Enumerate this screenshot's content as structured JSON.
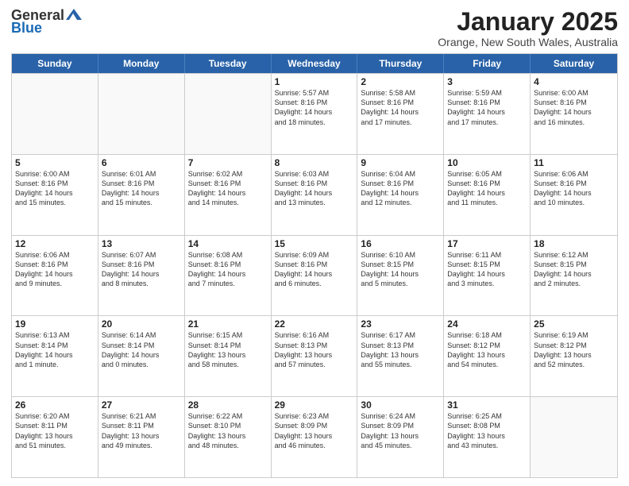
{
  "header": {
    "logo_line1": "General",
    "logo_line2": "Blue",
    "month_title": "January 2025",
    "location": "Orange, New South Wales, Australia"
  },
  "weekdays": [
    "Sunday",
    "Monday",
    "Tuesday",
    "Wednesday",
    "Thursday",
    "Friday",
    "Saturday"
  ],
  "rows": [
    [
      {
        "day": "",
        "info": ""
      },
      {
        "day": "",
        "info": ""
      },
      {
        "day": "",
        "info": ""
      },
      {
        "day": "1",
        "info": "Sunrise: 5:57 AM\nSunset: 8:16 PM\nDaylight: 14 hours\nand 18 minutes."
      },
      {
        "day": "2",
        "info": "Sunrise: 5:58 AM\nSunset: 8:16 PM\nDaylight: 14 hours\nand 17 minutes."
      },
      {
        "day": "3",
        "info": "Sunrise: 5:59 AM\nSunset: 8:16 PM\nDaylight: 14 hours\nand 17 minutes."
      },
      {
        "day": "4",
        "info": "Sunrise: 6:00 AM\nSunset: 8:16 PM\nDaylight: 14 hours\nand 16 minutes."
      }
    ],
    [
      {
        "day": "5",
        "info": "Sunrise: 6:00 AM\nSunset: 8:16 PM\nDaylight: 14 hours\nand 15 minutes."
      },
      {
        "day": "6",
        "info": "Sunrise: 6:01 AM\nSunset: 8:16 PM\nDaylight: 14 hours\nand 15 minutes."
      },
      {
        "day": "7",
        "info": "Sunrise: 6:02 AM\nSunset: 8:16 PM\nDaylight: 14 hours\nand 14 minutes."
      },
      {
        "day": "8",
        "info": "Sunrise: 6:03 AM\nSunset: 8:16 PM\nDaylight: 14 hours\nand 13 minutes."
      },
      {
        "day": "9",
        "info": "Sunrise: 6:04 AM\nSunset: 8:16 PM\nDaylight: 14 hours\nand 12 minutes."
      },
      {
        "day": "10",
        "info": "Sunrise: 6:05 AM\nSunset: 8:16 PM\nDaylight: 14 hours\nand 11 minutes."
      },
      {
        "day": "11",
        "info": "Sunrise: 6:06 AM\nSunset: 8:16 PM\nDaylight: 14 hours\nand 10 minutes."
      }
    ],
    [
      {
        "day": "12",
        "info": "Sunrise: 6:06 AM\nSunset: 8:16 PM\nDaylight: 14 hours\nand 9 minutes."
      },
      {
        "day": "13",
        "info": "Sunrise: 6:07 AM\nSunset: 8:16 PM\nDaylight: 14 hours\nand 8 minutes."
      },
      {
        "day": "14",
        "info": "Sunrise: 6:08 AM\nSunset: 8:16 PM\nDaylight: 14 hours\nand 7 minutes."
      },
      {
        "day": "15",
        "info": "Sunrise: 6:09 AM\nSunset: 8:16 PM\nDaylight: 14 hours\nand 6 minutes."
      },
      {
        "day": "16",
        "info": "Sunrise: 6:10 AM\nSunset: 8:15 PM\nDaylight: 14 hours\nand 5 minutes."
      },
      {
        "day": "17",
        "info": "Sunrise: 6:11 AM\nSunset: 8:15 PM\nDaylight: 14 hours\nand 3 minutes."
      },
      {
        "day": "18",
        "info": "Sunrise: 6:12 AM\nSunset: 8:15 PM\nDaylight: 14 hours\nand 2 minutes."
      }
    ],
    [
      {
        "day": "19",
        "info": "Sunrise: 6:13 AM\nSunset: 8:14 PM\nDaylight: 14 hours\nand 1 minute."
      },
      {
        "day": "20",
        "info": "Sunrise: 6:14 AM\nSunset: 8:14 PM\nDaylight: 14 hours\nand 0 minutes."
      },
      {
        "day": "21",
        "info": "Sunrise: 6:15 AM\nSunset: 8:14 PM\nDaylight: 13 hours\nand 58 minutes."
      },
      {
        "day": "22",
        "info": "Sunrise: 6:16 AM\nSunset: 8:13 PM\nDaylight: 13 hours\nand 57 minutes."
      },
      {
        "day": "23",
        "info": "Sunrise: 6:17 AM\nSunset: 8:13 PM\nDaylight: 13 hours\nand 55 minutes."
      },
      {
        "day": "24",
        "info": "Sunrise: 6:18 AM\nSunset: 8:12 PM\nDaylight: 13 hours\nand 54 minutes."
      },
      {
        "day": "25",
        "info": "Sunrise: 6:19 AM\nSunset: 8:12 PM\nDaylight: 13 hours\nand 52 minutes."
      }
    ],
    [
      {
        "day": "26",
        "info": "Sunrise: 6:20 AM\nSunset: 8:11 PM\nDaylight: 13 hours\nand 51 minutes."
      },
      {
        "day": "27",
        "info": "Sunrise: 6:21 AM\nSunset: 8:11 PM\nDaylight: 13 hours\nand 49 minutes."
      },
      {
        "day": "28",
        "info": "Sunrise: 6:22 AM\nSunset: 8:10 PM\nDaylight: 13 hours\nand 48 minutes."
      },
      {
        "day": "29",
        "info": "Sunrise: 6:23 AM\nSunset: 8:09 PM\nDaylight: 13 hours\nand 46 minutes."
      },
      {
        "day": "30",
        "info": "Sunrise: 6:24 AM\nSunset: 8:09 PM\nDaylight: 13 hours\nand 45 minutes."
      },
      {
        "day": "31",
        "info": "Sunrise: 6:25 AM\nSunset: 8:08 PM\nDaylight: 13 hours\nand 43 minutes."
      },
      {
        "day": "",
        "info": ""
      }
    ]
  ]
}
